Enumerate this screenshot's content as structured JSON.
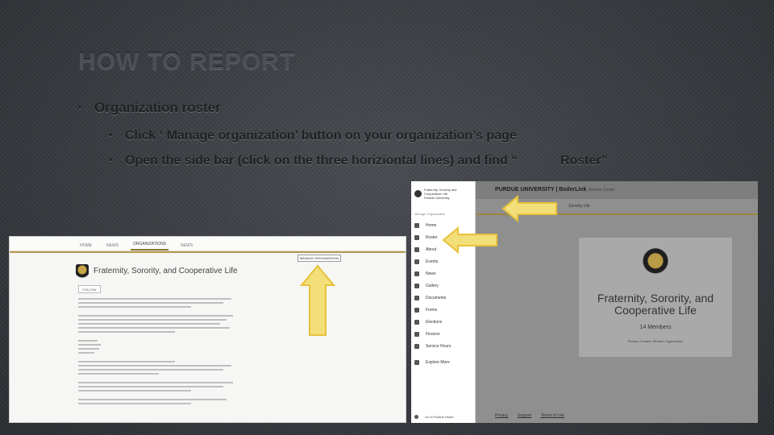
{
  "slide": {
    "title": "HOW TO REPORT",
    "bullets": [
      "Organization roster",
      "Click ‘ Manage organization’ button on your organization’s page",
      "Open the side bar (click on the three horiziontal lines) and find “",
      "Roster”"
    ],
    "bullet_glyph": "•"
  },
  "left_screenshot": {
    "tabs": [
      "HOME",
      "NEWS",
      "ORGANIZATIONS",
      "NEWS"
    ],
    "manage_button": "MANAGE ORGANIZATION",
    "org_name": "Fraternity, Sorority, and Cooperative Life",
    "follow_button": "FOLLOW"
  },
  "right_screenshot": {
    "header_title": "PURDUE UNIVERSITY | BoilerLink",
    "actions": "Actions Center",
    "sub_title": "Sorority Life",
    "sidebar": {
      "org_line1": "Fraternity, Sorority and",
      "org_line2": "Cooperative Life",
      "org_line3": "Purdue University",
      "section": "Manage Organization",
      "items": [
        "Home",
        "Roster",
        "About",
        "Events",
        "News",
        "Gallery",
        "Documents",
        "Forms",
        "Elections",
        "Finance",
        "Service Hours",
        "Explore More"
      ],
      "bottom": "Go to Purdue Home"
    },
    "card": {
      "title": "Fraternity, Sorority, and Cooperative Life",
      "members": "14 Members",
      "sub": "Primary Contact: Student Organization"
    },
    "footer": [
      "Privacy",
      "Support",
      "Terms of Use"
    ]
  },
  "colors": {
    "accent_gold": "#b59a4b",
    "arrow_yellow": "#f2df79",
    "arrow_outline": "#e6c23b"
  }
}
